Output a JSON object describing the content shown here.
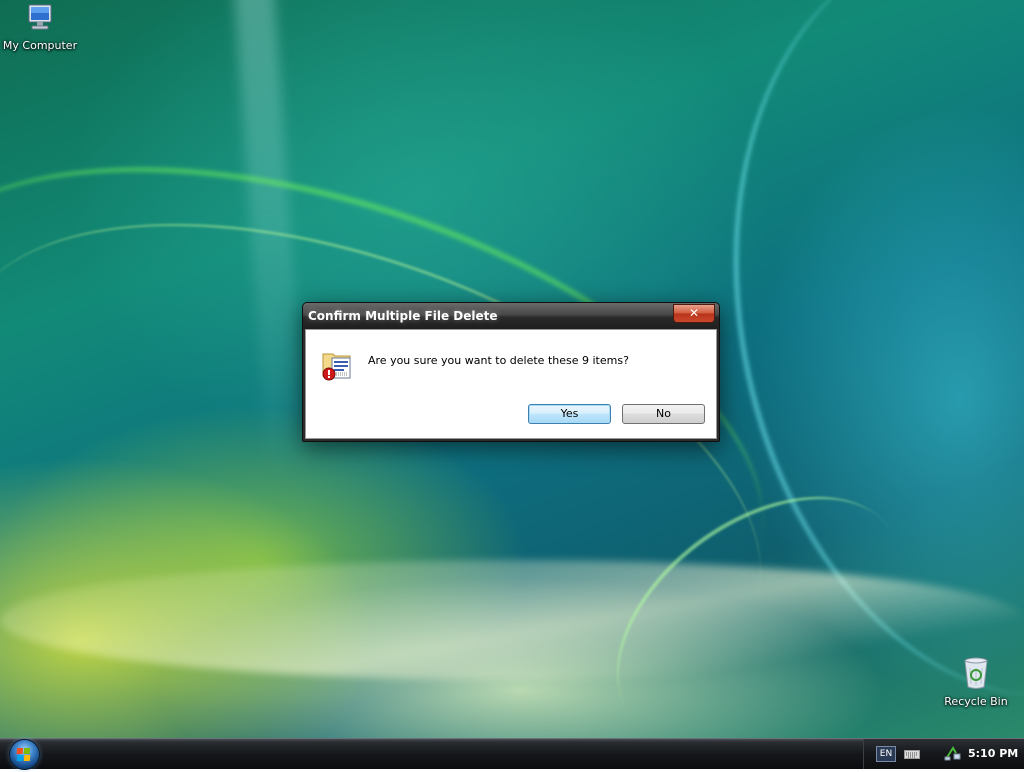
{
  "desktop": {
    "icons": [
      {
        "label": "My Computer",
        "icon": "computer-icon"
      },
      {
        "label": "Recycle Bin",
        "icon": "recycle-bin-icon"
      }
    ]
  },
  "dialog": {
    "title": "Confirm Multiple File Delete",
    "close_label": "✕",
    "icon": "delete-files-warning-icon",
    "message": "Are you sure you want to delete these 9 items?",
    "buttons": {
      "yes": "Yes",
      "no": "No"
    },
    "default_button": "yes"
  },
  "taskbar": {
    "start_icon": "windows-start-orb",
    "tray": {
      "language": "EN",
      "keyboard_icon": "keyboard-icon",
      "network_icon": "network-icon",
      "clock": "5:10 PM"
    }
  },
  "colors": {
    "titlebar": "#2b2b2b",
    "close_button": "#c94a2d",
    "default_button_border": "#3c7fb1",
    "taskbar": "#15171a"
  }
}
